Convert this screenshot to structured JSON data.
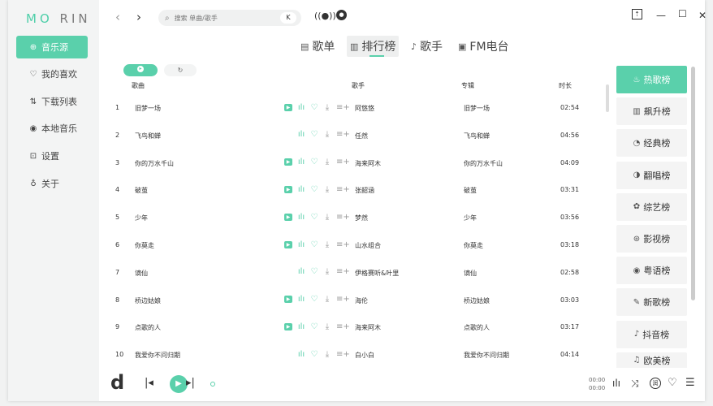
{
  "app": {
    "logo_a": "MO",
    "logo_b": "RIN"
  },
  "sidebar": {
    "items": [
      {
        "label": "音乐源",
        "icon": "source-icon",
        "active": true
      },
      {
        "label": "我的喜欢",
        "icon": "heart-icon",
        "active": false
      },
      {
        "label": "下载列表",
        "icon": "download-list-icon",
        "active": false
      },
      {
        "label": "本地音乐",
        "icon": "local-music-icon",
        "active": false
      },
      {
        "label": "设置",
        "icon": "settings-icon",
        "active": false
      },
      {
        "label": "关于",
        "icon": "about-icon",
        "active": false
      }
    ]
  },
  "topbar": {
    "search_placeholder": "搜索 单曲/歌手",
    "source_badge": "K"
  },
  "tabs": [
    {
      "label": "歌单",
      "icon": "playlist-icon",
      "active": false
    },
    {
      "label": "排行榜",
      "icon": "chart-icon",
      "active": true
    },
    {
      "label": "歌手",
      "icon": "singer-icon",
      "active": false
    },
    {
      "label": "FM电台",
      "icon": "radio-icon",
      "active": false
    }
  ],
  "table": {
    "headers": {
      "title": "歌曲",
      "artist": "歌手",
      "album": "专辑",
      "duration": "时长"
    },
    "rows": [
      {
        "num": "1",
        "title": "旧梦一场",
        "artist": "阿悠悠",
        "album": "旧梦一场",
        "duration": "02:54",
        "mv": true
      },
      {
        "num": "2",
        "title": "飞鸟和蝉",
        "artist": "任然",
        "album": "飞鸟和蝉",
        "duration": "04:56",
        "mv": false
      },
      {
        "num": "3",
        "title": "你的万水千山",
        "artist": "海来阿木",
        "album": "你的万水千山",
        "duration": "04:09",
        "mv": true
      },
      {
        "num": "4",
        "title": "破茧",
        "artist": "张韶涵",
        "album": "破茧",
        "duration": "03:31",
        "mv": true
      },
      {
        "num": "5",
        "title": "少年",
        "artist": "梦然",
        "album": "少年",
        "duration": "03:56",
        "mv": true
      },
      {
        "num": "6",
        "title": "你莫走",
        "artist": "山水组合",
        "album": "你莫走",
        "duration": "03:18",
        "mv": true
      },
      {
        "num": "7",
        "title": "谪仙",
        "artist": "伊格赛听&叶里",
        "album": "谪仙",
        "duration": "02:58",
        "mv": false
      },
      {
        "num": "8",
        "title": "桥边姑娘",
        "artist": "海伦",
        "album": "桥边姑娘",
        "duration": "03:03",
        "mv": true
      },
      {
        "num": "9",
        "title": "点歌的人",
        "artist": "海来阿木",
        "album": "点歌的人",
        "duration": "03:17",
        "mv": true
      },
      {
        "num": "10",
        "title": "我爱你不问归期",
        "artist": "白小白",
        "album": "我爱你不问归期",
        "duration": "04:14",
        "mv": false
      }
    ]
  },
  "rankings": [
    {
      "label": "热歌榜",
      "icon": "hot-icon",
      "active": true
    },
    {
      "label": "飙升榜",
      "icon": "rising-icon",
      "active": false
    },
    {
      "label": "经典榜",
      "icon": "classic-icon",
      "active": false
    },
    {
      "label": "翻唱榜",
      "icon": "cover-icon",
      "active": false
    },
    {
      "label": "综艺榜",
      "icon": "variety-icon",
      "active": false
    },
    {
      "label": "影视榜",
      "icon": "film-icon",
      "active": false
    },
    {
      "label": "粤语榜",
      "icon": "cantonese-icon",
      "active": false
    },
    {
      "label": "新歌榜",
      "icon": "new-icon",
      "active": false
    },
    {
      "label": "抖音榜",
      "icon": "douyin-icon",
      "active": false
    },
    {
      "label": "欧美榜",
      "icon": "western-icon",
      "active": false
    }
  ],
  "player": {
    "time_current": "00:00",
    "time_total": "00:00",
    "quality_badge": "润"
  },
  "colors": {
    "accent": "#5ad0ab",
    "sidebar_bg": "#f3f4f4"
  }
}
